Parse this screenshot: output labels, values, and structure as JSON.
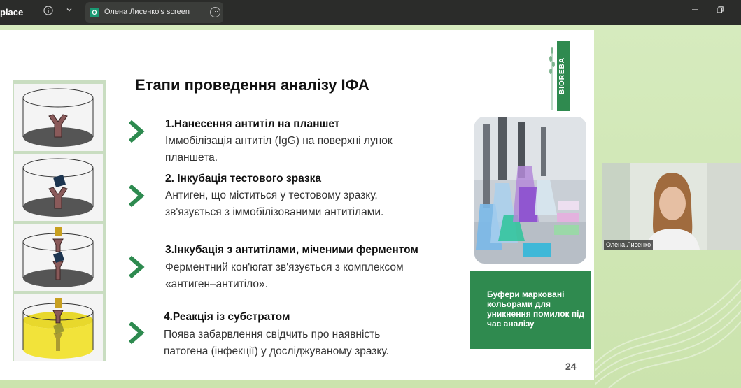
{
  "app": {
    "name": "place"
  },
  "tab": {
    "avatar_letter": "O",
    "title": "Олена Лисенко's screen"
  },
  "slide": {
    "title": "Етапи проведення аналізу ІФА",
    "steps": [
      {
        "title": "1.Нанесення антитіл на планшет",
        "desc": [
          "Іммобілізація антитіл (IgG) на поверхні лунок",
          "планшета."
        ]
      },
      {
        "title": "2. Інкубація тестового зразка",
        "desc": [
          "Антиген, що міститься у тестовому зразку,",
          "зв'язується з іммобілізованими антитілами."
        ]
      },
      {
        "title": "3.Інкубація з антитілами, міченими ферментом",
        "desc": [
          "Ферментний кон'югат зв'язується з комплексом",
          "«антиген–антитіло»."
        ]
      },
      {
        "title": "4.Реакція із субстратом",
        "desc": [
          "Поява забарвлення свідчить про наявність",
          "патогена (інфекції) у досліджуваному зразку."
        ]
      }
    ],
    "logo_text": "BIOREBA",
    "info_box": "Буфери марковані кольорами для уникнення помилок під час аналізу",
    "page_number": "24"
  },
  "webcam": {
    "name": "Олена Лисенко"
  },
  "colors": {
    "accent": "#2f8a4f",
    "topbar": "#2b2c2a"
  }
}
